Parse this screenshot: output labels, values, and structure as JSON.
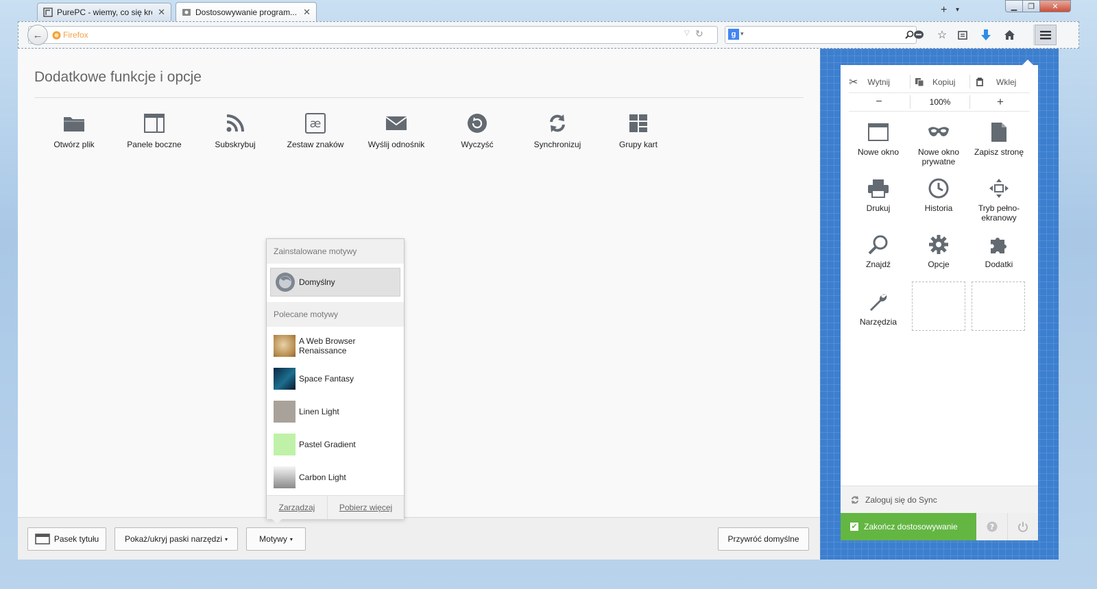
{
  "tabs": [
    {
      "label": "PurePC - wiemy, co się kręci!",
      "active": false
    },
    {
      "label": "Dostosowywanie program...",
      "active": true
    }
  ],
  "url": {
    "placeholder": "Firefox",
    "value": ""
  },
  "palette": {
    "title": "Dodatkowe funkcje i opcje",
    "items": [
      {
        "label": "Otwórz plik",
        "icon": "folder-icon"
      },
      {
        "label": "Panele boczne",
        "icon": "sidebar-icon"
      },
      {
        "label": "Subskrybuj",
        "icon": "rss-icon"
      },
      {
        "label": "Zestaw znaków",
        "icon": "charset-icon"
      },
      {
        "label": "Wyślij odnośnik",
        "icon": "mail-icon"
      },
      {
        "label": "Wyczyść",
        "icon": "forget-icon"
      },
      {
        "label": "Synchronizuj",
        "icon": "sync-icon"
      },
      {
        "label": "Grupy kart",
        "icon": "tab-groups-icon"
      }
    ]
  },
  "themes_popup": {
    "installed_header": "Zainstalowane motywy",
    "installed": [
      {
        "label": "Domyślny"
      }
    ],
    "featured_header": "Polecane motywy",
    "featured": [
      {
        "label": "A Web Browser Renaissance"
      },
      {
        "label": "Space Fantasy"
      },
      {
        "label": "Linen Light"
      },
      {
        "label": "Pastel Gradient"
      },
      {
        "label": "Carbon Light"
      }
    ],
    "manage": "Zarządzaj",
    "get_more": "Pobierz więcej"
  },
  "bottom_bar": {
    "title_bar": "Pasek tytułu",
    "toolbars": "Pokaż/ukryj paski narzędzi",
    "themes": "Motywy",
    "restore": "Przywróć domyślne"
  },
  "menu_panel": {
    "cut": "Wytnij",
    "copy": "Kopiuj",
    "paste": "Wklej",
    "zoom_out": "−",
    "zoom": "100%",
    "zoom_in": "+",
    "items": [
      {
        "label": "Nowe okno",
        "icon": "new-window-icon"
      },
      {
        "label": "Nowe okno prywatne",
        "icon": "private-mask-icon"
      },
      {
        "label": "Zapisz stronę",
        "icon": "save-page-icon"
      },
      {
        "label": "Drukuj",
        "icon": "printer-icon"
      },
      {
        "label": "Historia",
        "icon": "history-clock-icon"
      },
      {
        "label": "Tryb pełno-ekranowy",
        "icon": "fullscreen-icon"
      },
      {
        "label": "Znajdź",
        "icon": "find-magnifier-icon"
      },
      {
        "label": "Opcje",
        "icon": "options-gear-icon"
      },
      {
        "label": "Dodatki",
        "icon": "addons-puzzle-icon"
      },
      {
        "label": "Narzędzia",
        "icon": "wrench-icon"
      }
    ],
    "sync": "Zaloguj się do Sync",
    "finish": "Zakończ dostosowywanie"
  },
  "colors": {
    "accent_green": "#64b643",
    "panel_blue": "#3d7fcf"
  }
}
